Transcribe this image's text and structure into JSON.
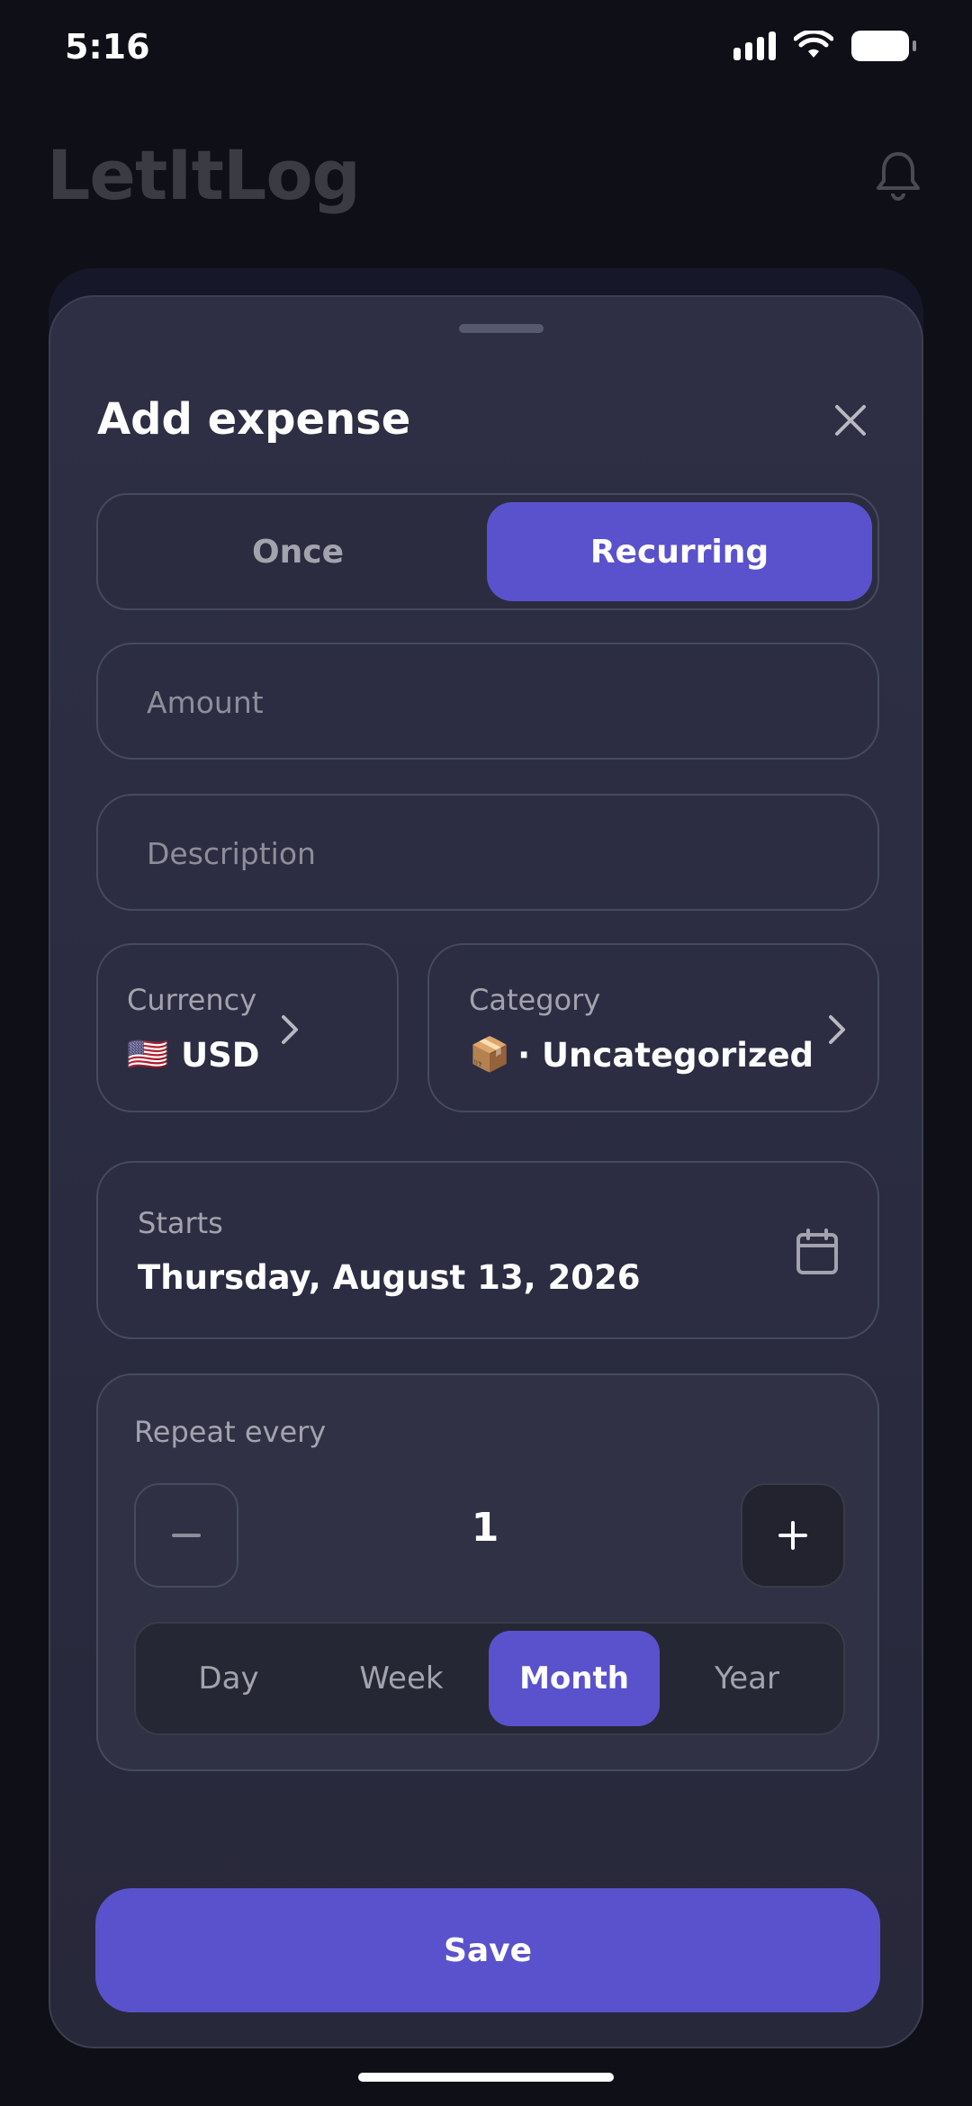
{
  "status_bar": {
    "time": "5:16"
  },
  "app": {
    "title": "LetItLog"
  },
  "sheet": {
    "title": "Add expense",
    "mode_options": [
      {
        "label": "Once",
        "selected": false
      },
      {
        "label": "Recurring",
        "selected": true
      }
    ],
    "amount": {
      "placeholder": "Amount",
      "value": ""
    },
    "description": {
      "placeholder": "Description",
      "value": ""
    },
    "currency": {
      "label": "Currency",
      "flag": "🇺🇸",
      "value": "USD"
    },
    "category": {
      "label": "Category",
      "emoji": "📦",
      "value": "· Uncategorized"
    },
    "starts": {
      "label": "Starts",
      "value": "Thursday, August 13, 2026"
    },
    "repeat": {
      "label": "Repeat every",
      "count": "1",
      "units": [
        {
          "label": "Day",
          "selected": false
        },
        {
          "label": "Week",
          "selected": false
        },
        {
          "label": "Month",
          "selected": true
        },
        {
          "label": "Year",
          "selected": false
        }
      ]
    },
    "save_label": "Save"
  },
  "colors": {
    "accent": "#5a52cc",
    "background": "#0f0f17",
    "sheet": "#2c2d42"
  },
  "icons": [
    "signal-icon",
    "wifi-icon",
    "battery-icon",
    "bell-icon",
    "close-icon",
    "chevron-right-icon",
    "calendar-icon",
    "minus-icon",
    "plus-icon"
  ]
}
